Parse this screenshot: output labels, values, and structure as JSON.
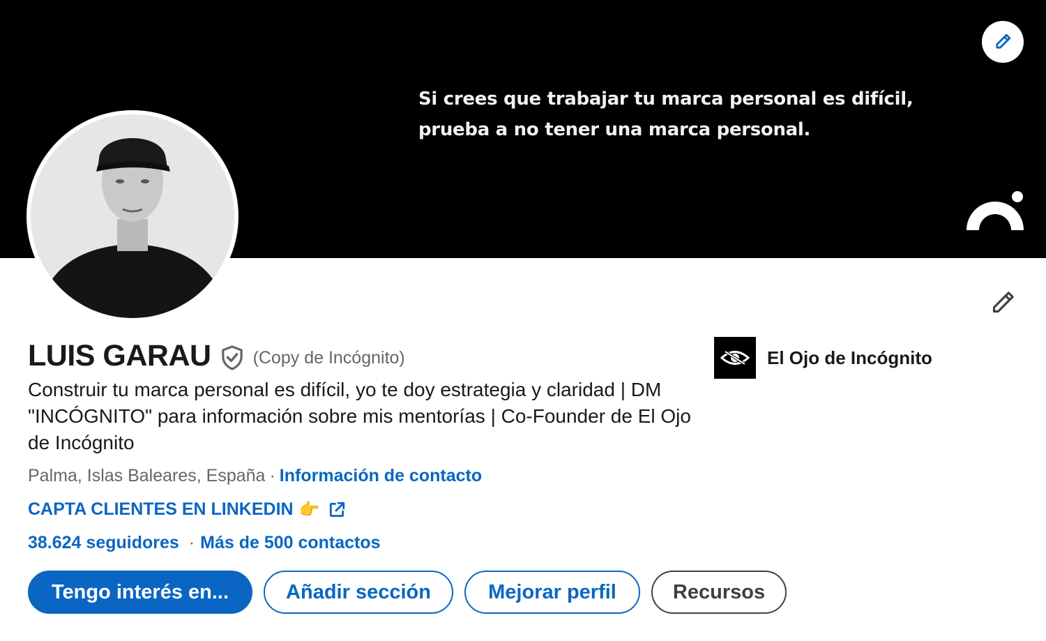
{
  "banner": {
    "quote_lines": [
      "Si crees que trabajar tu marca personal es difícil,",
      "prueba a no tener una marca personal."
    ],
    "edit_icon": "pencil-icon"
  },
  "profile": {
    "name": "LUIS GARAU",
    "verified_icon": "shield-check-icon",
    "pronoun": "(Copy de Incógnito)",
    "headline": "Construir tu marca personal es difícil, yo te doy estrategia y claridad | DM \"INCÓGNITO\" para información sobre mis mentorías | Co-Founder de El Ojo de Incógnito",
    "location": "Palma, Islas Baleares, España",
    "location_separator": "·",
    "contact_link": "Información de contacto",
    "website_label": "CAPTA CLIENTES EN LINKEDIN",
    "website_emoji": "👉",
    "external_link_icon": "external-link-icon",
    "followers": "38.624 seguidores",
    "stats_separator": "·",
    "connections": "Más de 500 contactos"
  },
  "company": {
    "name": "El Ojo de Incógnito",
    "logo_icon": "eye-logo-icon"
  },
  "actions": {
    "primary": "Tengo interés en...",
    "add_section": "Añadir sección",
    "improve_profile": "Mejorar perfil",
    "resources": "Recursos"
  },
  "colors": {
    "accent": "#0a66c2",
    "text": "#191919",
    "muted": "#666666",
    "banner_bg": "#000000"
  }
}
